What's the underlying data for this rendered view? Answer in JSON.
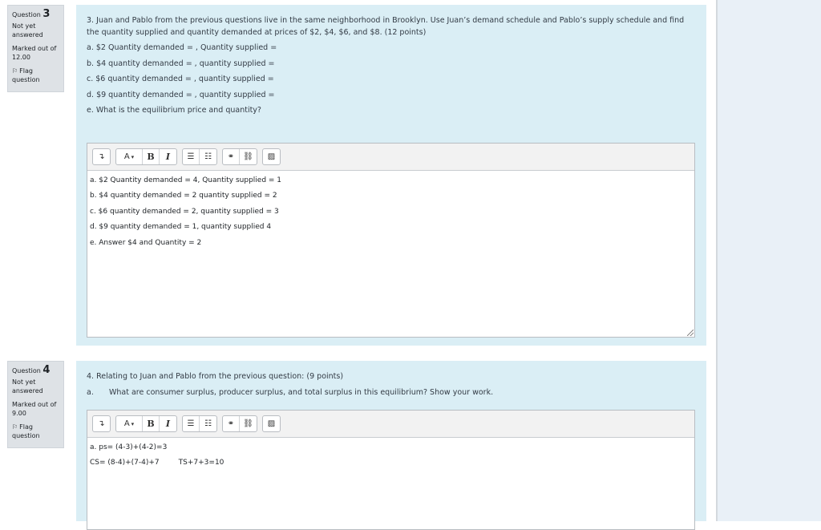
{
  "questions": [
    {
      "info": {
        "label": "Question",
        "number": "3",
        "state": "Not yet answered",
        "grade": "Marked out of 12.00",
        "flag_label": "Flag question"
      },
      "prompt": "3. Juan and Pablo from the previous questions live in the same neighborhood in Brooklyn. Use Juan’s demand schedule and Pablo’s supply schedule and find the quantity supplied and quantity demanded at prices of $2, $4, $6, and $8. (12 points)",
      "sub_items": [
        "a. $2 Quantity demanded = , Quantity supplied =",
        "b. $4 quantity demanded = , quantity supplied =",
        "c. $6 quantity demanded = , quantity supplied =",
        "d. $9 quantity demanded = , quantity supplied =",
        "e. What is the equilibrium price and quantity?"
      ],
      "answer_lines": [
        "a. $2 Quantity demanded = 4, Quantity supplied = 1",
        "b. $4 quantity demanded = 2 quantity supplied = 2",
        "c. $6 quantity demanded = 2, quantity supplied = 3",
        "d. $9 quantity demanded = 1, quantity supplied 4",
        "e. Answer $4 and Quantity = 2"
      ]
    },
    {
      "info": {
        "label": "Question",
        "number": "4",
        "state": "Not yet answered",
        "grade": "Marked out of 9.00",
        "flag_label": "Flag question"
      },
      "prompt": "4. Relating to Juan and Pablo from the previous question: (9 points)",
      "sub_a_label": "a.",
      "sub_a_text": "What are consumer surplus, producer surplus, and total surplus in this equilibrium? Show your work.",
      "answer_lines": [
        "a. ps= (4-3)+(4-2)=3",
        "CS= (8-4)+(7-4)+7"
      ],
      "answer_line2_extra": "TS+7+3=10"
    }
  ],
  "toolbar": {
    "expand_icon": "↴",
    "font_color": "A",
    "dropdown_caret": "▾",
    "bold": "B",
    "italic": "I",
    "unordered_list_icon": "☰",
    "ordered_list_icon": "☷",
    "link_icon": "⚭",
    "unlink_icon": "⛓",
    "image_icon": "▨"
  },
  "flag_icon": "⚐"
}
